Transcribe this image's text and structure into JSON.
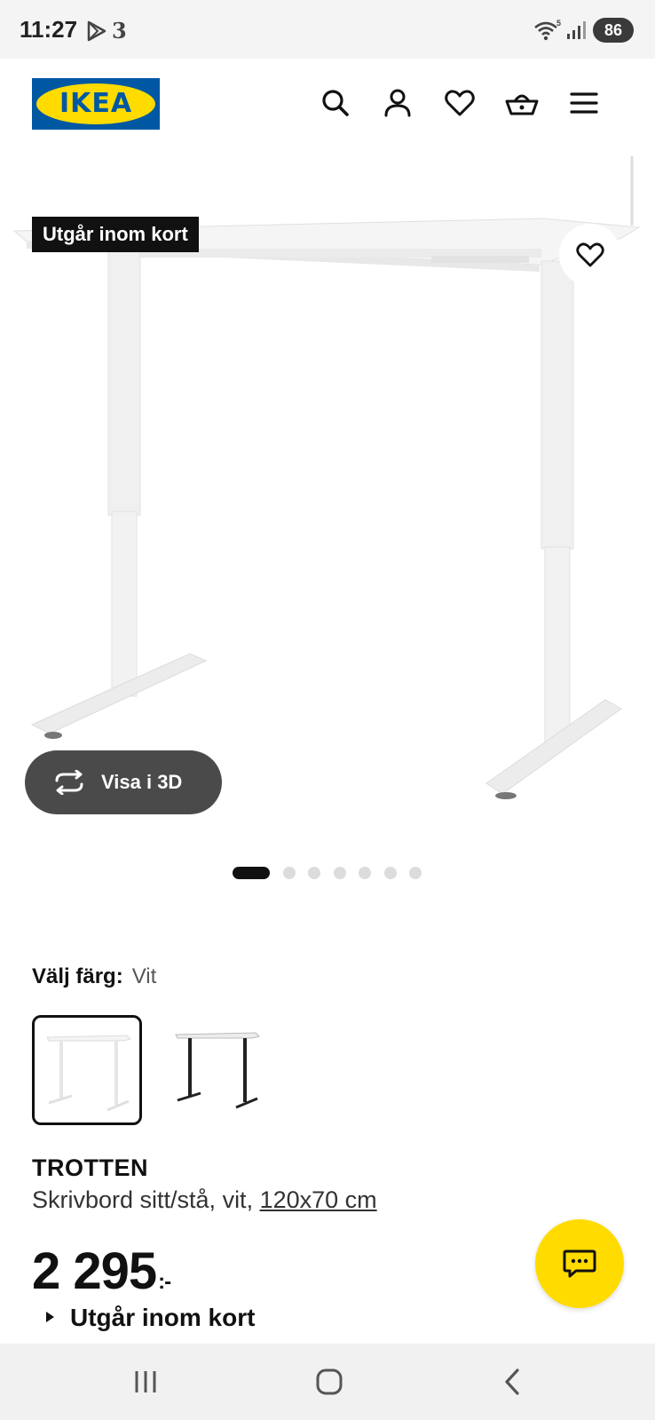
{
  "status_bar": {
    "time": "11:27",
    "carrier_glyph": "3",
    "battery": "86",
    "icons": [
      "play-store-icon",
      "wifi-icon",
      "signal-icon",
      "battery-icon"
    ]
  },
  "header": {
    "logo_text": "IKEA",
    "icons": [
      "search-icon",
      "account-icon",
      "wishlist-icon",
      "cart-icon",
      "menu-icon"
    ]
  },
  "hero": {
    "badge": "Utgår inom kort",
    "view_3d_label": "Visa i 3D",
    "carousel_count": 7,
    "carousel_active": 0
  },
  "color_choice": {
    "label": "Välj färg:",
    "value": "Vit",
    "options": [
      "white",
      "black"
    ],
    "selected": 0
  },
  "product": {
    "name": "TROTTEN",
    "description": "Skrivbord sitt/stå, vit, ",
    "size_link": "120x70 cm",
    "price": "2 295",
    "price_suffix": ":-",
    "availability": "Utgår inom kort"
  },
  "colors": {
    "ikea_blue": "#0058a3",
    "ikea_yellow": "#ffdb00",
    "badge_bg": "#111111",
    "button_3d_bg": "#4a4a4a"
  },
  "nav_bar": {
    "icons": [
      "recent-apps-icon",
      "home-icon",
      "back-icon"
    ]
  }
}
